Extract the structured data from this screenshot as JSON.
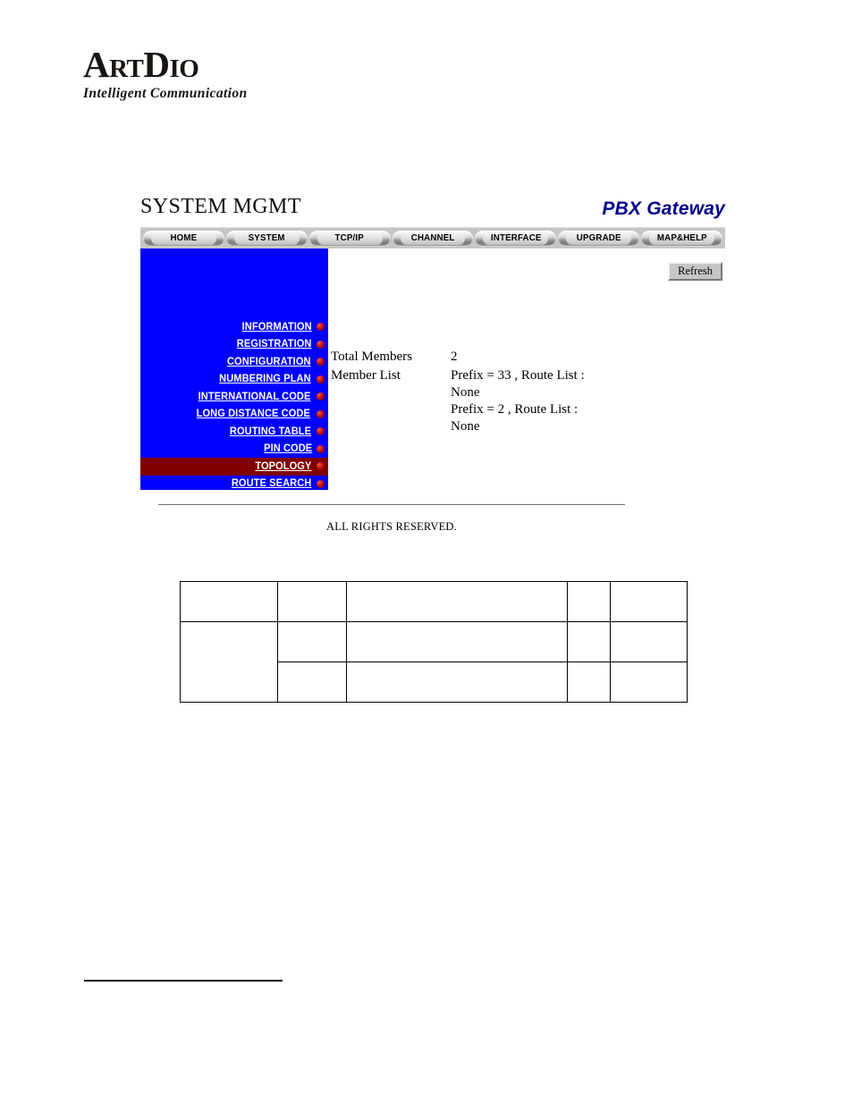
{
  "brand": {
    "name_cap_a": "A",
    "name_sc_rt": "RT",
    "name_cap_d": "D",
    "name_sc_io": "IO",
    "name_full": "ArtDio",
    "tagline": "Intelligent Communication"
  },
  "app": {
    "title": "SYSTEM MGMT",
    "product": "PBX Gateway",
    "nav_tabs": [
      {
        "label": "HOME"
      },
      {
        "label": "SYSTEM"
      },
      {
        "label": "TCP/IP"
      },
      {
        "label": "CHANNEL"
      },
      {
        "label": "INTERFACE"
      },
      {
        "label": "UPGRADE"
      },
      {
        "label": "MAP&HELP"
      }
    ],
    "sidebar": {
      "background_color": "#0000FF",
      "active_color": "#800000",
      "bullet_icon": "red-sphere-bullet-icon",
      "items": [
        {
          "label": "INFORMATION",
          "active": false
        },
        {
          "label": "REGISTRATION",
          "active": false
        },
        {
          "label": "CONFIGURATION",
          "active": false
        },
        {
          "label": "NUMBERING PLAN",
          "active": false
        },
        {
          "label": "INTERNATIONAL CODE",
          "active": false
        },
        {
          "label": "LONG DISTANCE CODE",
          "active": false
        },
        {
          "label": "ROUTING TABLE",
          "active": false
        },
        {
          "label": "PIN CODE",
          "active": false
        },
        {
          "label": "TOPOLOGY",
          "active": true
        },
        {
          "label": "ROUTE SEARCH",
          "active": false
        }
      ]
    },
    "content": {
      "refresh_label": "Refresh",
      "total_members_label": "Total Members",
      "total_members_value": "2",
      "member_list_label": "Member List",
      "member_list": [
        {
          "line1": "Prefix = 33 , Route List :",
          "line2": "None"
        },
        {
          "line1": "Prefix = 2 , Route List :",
          "line2": "None"
        }
      ]
    },
    "footer": {
      "text": "ALL RIGHTS RESERVED."
    }
  },
  "blank_table": {
    "rows": [
      {
        "cells": [
          "",
          "",
          "",
          "",
          ""
        ]
      },
      {
        "cells": [
          "",
          "",
          "",
          "",
          ""
        ]
      },
      {
        "cells": [
          "",
          "",
          "",
          "",
          ""
        ]
      }
    ]
  }
}
